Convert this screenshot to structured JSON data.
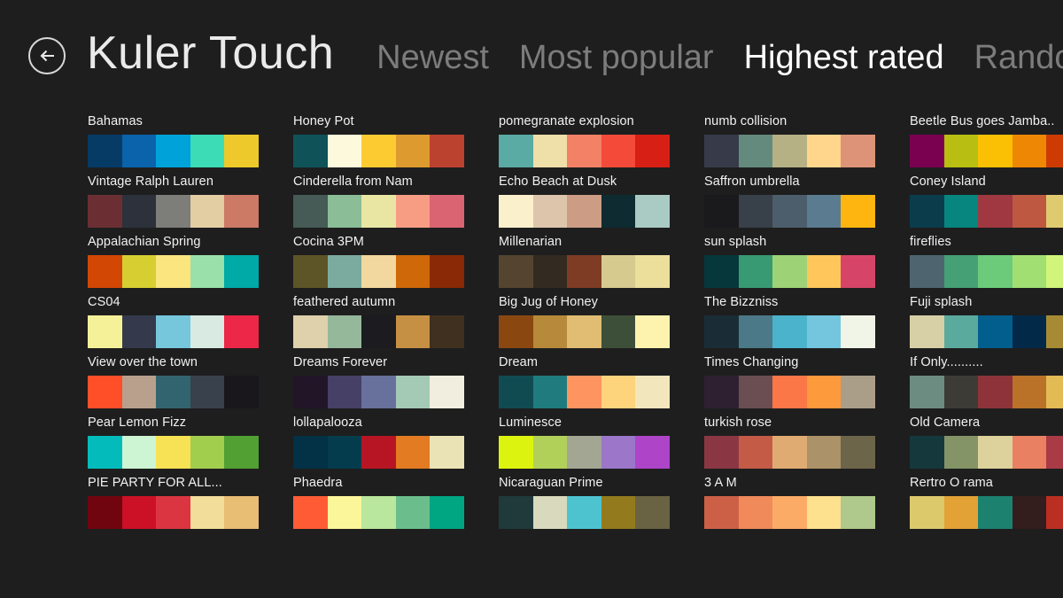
{
  "header": {
    "back_icon": "back-arrow-icon",
    "title": "Kuler Touch",
    "tabs": [
      {
        "label": "Newest",
        "active": false
      },
      {
        "label": "Most popular",
        "active": false
      },
      {
        "label": "Highest rated",
        "active": true
      },
      {
        "label": "Random",
        "active": false
      }
    ]
  },
  "theme": {
    "background": "#1e1e1e",
    "text": "#f2f2f2",
    "tab_inactive": "#7c7c7c",
    "tab_active": "#ffffff"
  },
  "palettes": [
    {
      "name": "Bahamas",
      "colors": [
        "#063b66",
        "#0a63ab",
        "#00a3d9",
        "#3bdcb6",
        "#edc92c"
      ]
    },
    {
      "name": "Vintage Ralph Lauren",
      "colors": [
        "#6b2f33",
        "#2c313c",
        "#7d7d79",
        "#e3cda3",
        "#cc7965"
      ]
    },
    {
      "name": "Appalachian Spring",
      "colors": [
        "#d24704",
        "#d7cf32",
        "#fae57e",
        "#9ae0ab",
        "#00aaa6"
      ]
    },
    {
      "name": "CS04",
      "colors": [
        "#f5f198",
        "#343a4c",
        "#76c7dc",
        "#d8eae2",
        "#ed2747"
      ]
    },
    {
      "name": "View over the town",
      "colors": [
        "#ff4f28",
        "#b9a08d",
        "#31646e",
        "#39414c",
        "#1a171c"
      ]
    },
    {
      "name": "Pear Lemon Fizz",
      "colors": [
        "#04bbbb",
        "#cdf4d3",
        "#f6e254",
        "#a2ce4e",
        "#52a033"
      ]
    },
    {
      "name": "PIE PARTY  FOR ALL...",
      "colors": [
        "#70040f",
        "#cc1127",
        "#db3541",
        "#f3dd9b",
        "#e8bd74"
      ]
    },
    {
      "name": "Honey Pot",
      "colors": [
        "#0f5359",
        "#fdf9dc",
        "#fccb32",
        "#dd9a2e",
        "#bc4230"
      ]
    },
    {
      "name": "Cinderella from Nam",
      "colors": [
        "#465b55",
        "#8bbd97",
        "#e9e6a3",
        "#f79d84",
        "#da6472"
      ]
    },
    {
      "name": "Cocina 3PM",
      "colors": [
        "#5d5527",
        "#7bab9f",
        "#f2d79e",
        "#ce6808",
        "#8a2905"
      ]
    },
    {
      "name": "feathered autumn",
      "colors": [
        "#ded1ab",
        "#95b79a",
        "#1b1b20",
        "#c69044",
        "#40301f"
      ]
    },
    {
      "name": "Dreams Forever",
      "colors": [
        "#211527",
        "#463f66",
        "#68719b",
        "#a4c9b4",
        "#f1eee0"
      ]
    },
    {
      "name": "lollapalooza",
      "colors": [
        "#033145",
        "#043c4d",
        "#b71524",
        "#e27b22",
        "#eae3b5"
      ]
    },
    {
      "name": "Phaedra",
      "colors": [
        "#ff5c36",
        "#fcf69b",
        "#b9e79d",
        "#6bbe8c",
        "#00a582"
      ]
    },
    {
      "name": "pomegranate explosion",
      "colors": [
        "#59aba3",
        "#efdfa8",
        "#f28166",
        "#f44a3a",
        "#d81f15"
      ]
    },
    {
      "name": "Echo Beach at Dusk",
      "colors": [
        "#fbf0cc",
        "#ddc5ac",
        "#cc9c85",
        "#0d2b30",
        "#a9cbc4"
      ]
    },
    {
      "name": "Millenarian",
      "colors": [
        "#554530",
        "#332a21",
        "#7e3c24",
        "#d7ca8f",
        "#ecdf9c"
      ]
    },
    {
      "name": "Big Jug of Honey",
      "colors": [
        "#8b4710",
        "#b7893a",
        "#e0bd73",
        "#3d4f39",
        "#fdf3af"
      ]
    },
    {
      "name": "Dream",
      "colors": [
        "#104b51",
        "#207b7e",
        "#fe9561",
        "#fdd37c",
        "#f2e6bc"
      ]
    },
    {
      "name": "Luminesce",
      "colors": [
        "#dcf30f",
        "#b1d05a",
        "#a3a692",
        "#9b76c9",
        "#ae45c9"
      ]
    },
    {
      "name": "Nicaraguan Prime",
      "colors": [
        "#20393a",
        "#d9d9bd",
        "#4dc3d0",
        "#937b1d",
        "#6a6343"
      ]
    },
    {
      "name": "numb collision",
      "colors": [
        "#373a49",
        "#648a7e",
        "#b5b184",
        "#ffd68c",
        "#dc9377"
      ]
    },
    {
      "name": "Saffron umbrella",
      "colors": [
        "#1a1a1c",
        "#384049",
        "#4c5d6b",
        "#5b7c90",
        "#ffb510"
      ]
    },
    {
      "name": "sun splash",
      "colors": [
        "#06373b",
        "#389a72",
        "#9ed276",
        "#ffc75b",
        "#d64568"
      ]
    },
    {
      "name": "The Bizzniss",
      "colors": [
        "#1a2d36",
        "#4b7987",
        "#4bb3cc",
        "#73c6dd",
        "#f1f5e7"
      ]
    },
    {
      "name": "Times Changing",
      "colors": [
        "#2e1f31",
        "#6a4e52",
        "#fc7748",
        "#fd9a3b",
        "#ab9e89"
      ]
    },
    {
      "name": "turkish rose",
      "colors": [
        "#8a3743",
        "#c35b47",
        "#e0ab73",
        "#ac9268",
        "#6d654a"
      ]
    },
    {
      "name": "3 A M",
      "colors": [
        "#cc6046",
        "#f08a5b",
        "#fbab66",
        "#fde18f",
        "#aec98b"
      ]
    },
    {
      "name": "Beetle Bus goes Jamba..",
      "colors": [
        "#7a0050",
        "#b8bf12",
        "#fbc004",
        "#ee8704",
        "#cd3b03"
      ]
    },
    {
      "name": "Coney Island",
      "colors": [
        "#0a3c4c",
        "#06867e",
        "#a03841",
        "#bf5840",
        "#e0ca70"
      ]
    },
    {
      "name": "fireflies",
      "colors": [
        "#4e6570",
        "#45a075",
        "#6bcb7b",
        "#a2df72",
        "#d0f57a"
      ]
    },
    {
      "name": "Fuji splash",
      "colors": [
        "#d7d0a7",
        "#5baa9e",
        "#015e8d",
        "#032948",
        "#a78b34"
      ]
    },
    {
      "name": "If Only..........",
      "colors": [
        "#6d8c81",
        "#3d3b36",
        "#8d3339",
        "#b97228",
        "#e2bb55"
      ]
    },
    {
      "name": "Old Camera",
      "colors": [
        "#14383c",
        "#849466",
        "#ddd29c",
        "#ea8062",
        "#a93b46"
      ]
    },
    {
      "name": "Rertro O rama",
      "colors": [
        "#dbc96c",
        "#e2a236",
        "#1d8170",
        "#331d1d",
        "#bb2f22"
      ]
    }
  ]
}
